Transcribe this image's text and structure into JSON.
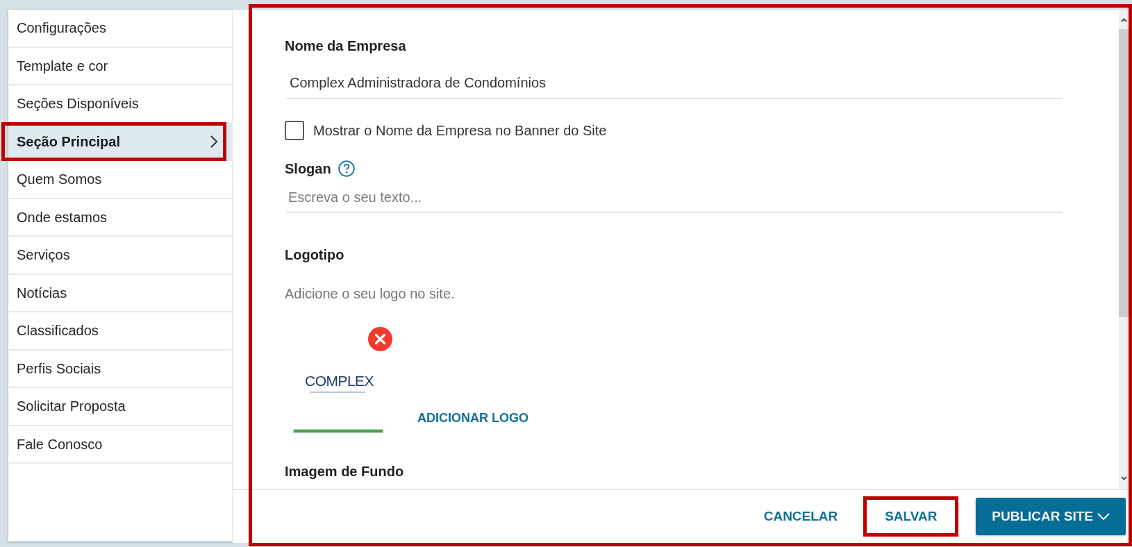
{
  "sidebar": {
    "items": [
      {
        "label": "Configurações",
        "selected": false,
        "highlighted": false
      },
      {
        "label": "Template e cor",
        "selected": false,
        "highlighted": false
      },
      {
        "label": "Seções Disponíveis",
        "selected": false,
        "highlighted": false
      },
      {
        "label": "Seção Principal",
        "selected": true,
        "highlighted": true
      },
      {
        "label": "Quem Somos",
        "selected": false,
        "highlighted": false
      },
      {
        "label": "Onde estamos",
        "selected": false,
        "highlighted": false
      },
      {
        "label": "Serviços",
        "selected": false,
        "highlighted": false
      },
      {
        "label": "Notícias",
        "selected": false,
        "highlighted": false
      },
      {
        "label": "Classificados",
        "selected": false,
        "highlighted": false
      },
      {
        "label": "Perfis Sociais",
        "selected": false,
        "highlighted": false
      },
      {
        "label": "Solicitar Proposta",
        "selected": false,
        "highlighted": false
      },
      {
        "label": "Fale Conosco",
        "selected": false,
        "highlighted": false
      }
    ]
  },
  "form_panel": {
    "highlighted": true,
    "company_name": {
      "label": "Nome da Empresa",
      "value": "Complex Administradora de Condomínios"
    },
    "show_name_in_banner": {
      "label": "Mostrar o Nome da Empresa no Banner do Site",
      "checked": false
    },
    "slogan": {
      "label": "Slogan",
      "placeholder": "Escreva o seu texto..."
    },
    "logo": {
      "label": "Logotipo",
      "hint": "Adicione o seu logo no site.",
      "image_text": "COMPLEX",
      "upload_progress": {
        "level": 1
      },
      "add_button": "ADICIONAR LOGO"
    },
    "background_image": {
      "label": "Imagem de Fundo"
    }
  },
  "footer": {
    "buttons": [
      {
        "label": "CANCELAR",
        "kind": "text",
        "highlighted": false,
        "dropdown": false
      },
      {
        "label": "SALVAR",
        "kind": "text",
        "highlighted": true,
        "dropdown": false
      },
      {
        "label": "PUBLICAR SITE",
        "kind": "primary",
        "highlighted": false,
        "dropdown": true
      }
    ]
  }
}
